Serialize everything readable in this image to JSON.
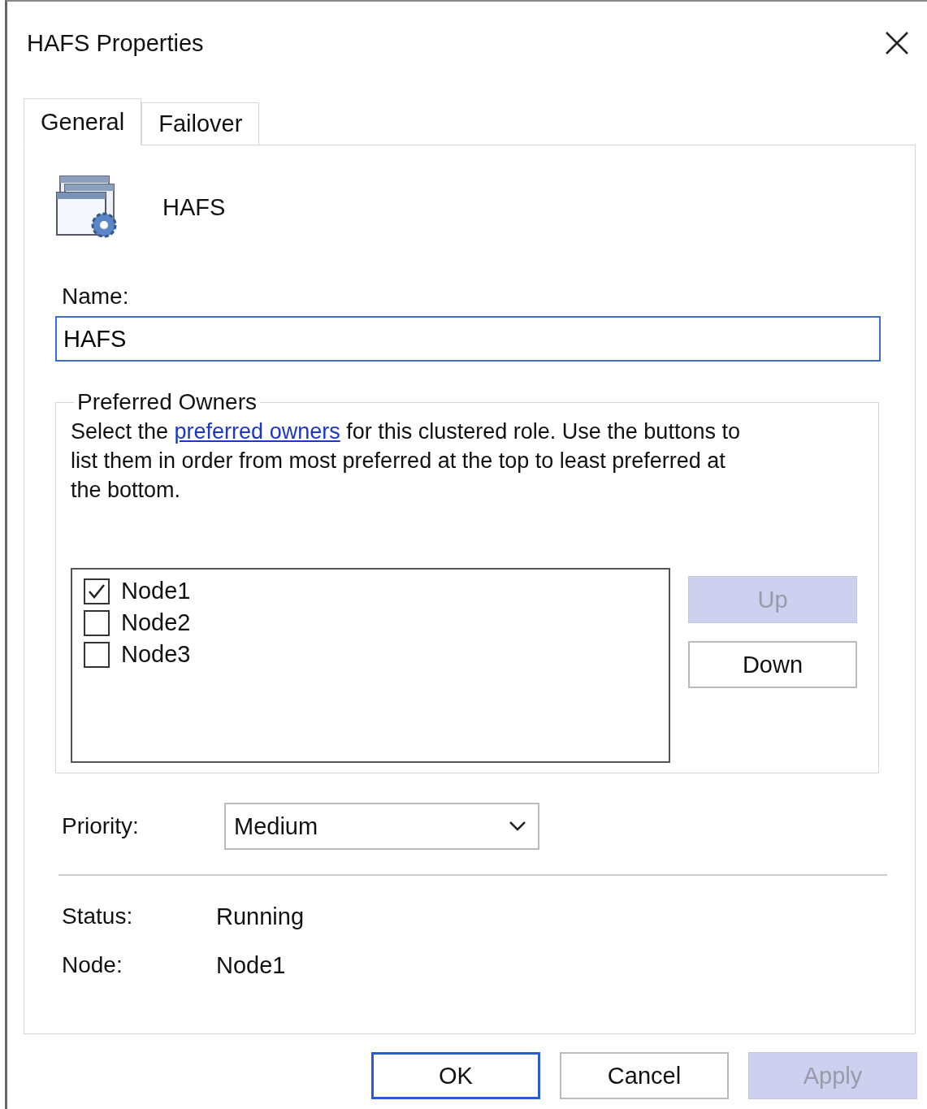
{
  "window": {
    "title": "HAFS Properties"
  },
  "tabs": [
    {
      "label": "General",
      "selected": true
    },
    {
      "label": "Failover",
      "selected": false
    }
  ],
  "role": {
    "name": "HAFS"
  },
  "name_field": {
    "label": "Name:",
    "value": "HAFS"
  },
  "preferred_owners": {
    "title": "Preferred Owners",
    "text_before": "Select the ",
    "link": "preferred owners",
    "text_after": " for this clustered role. Use the buttons to list them in order from most preferred at the top to least preferred at the bottom.",
    "nodes": [
      {
        "label": "Node1",
        "checked": true
      },
      {
        "label": "Node2",
        "checked": false
      },
      {
        "label": "Node3",
        "checked": false
      }
    ],
    "buttons": [
      {
        "label": "Up",
        "disabled": true
      },
      {
        "label": "Down",
        "disabled": false
      }
    ]
  },
  "priority": {
    "label": "Priority:",
    "value": "Medium"
  },
  "details": [
    {
      "label": "Status:",
      "value": "Running"
    },
    {
      "label": "Node:",
      "value": "Node1"
    }
  ],
  "footer_buttons": [
    {
      "label": "OK",
      "default": true,
      "disabled": false
    },
    {
      "label": "Cancel",
      "default": false,
      "disabled": false
    },
    {
      "label": "Apply",
      "default": false,
      "disabled": true
    }
  ]
}
